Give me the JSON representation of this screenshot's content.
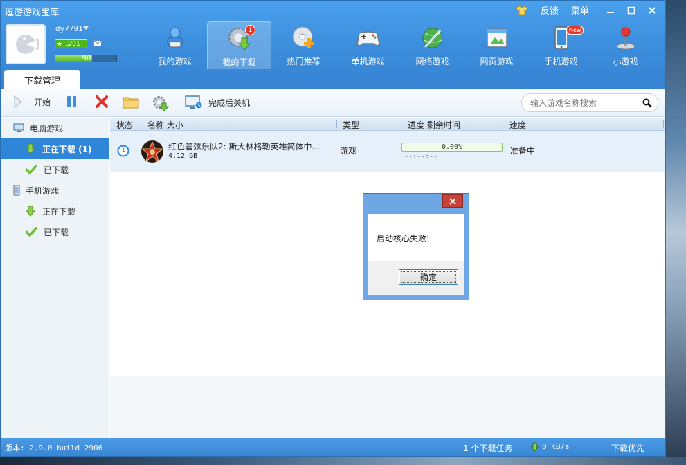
{
  "app": {
    "title": "逗游游戏宝库",
    "feedback": "反馈",
    "menu": "菜单"
  },
  "user": {
    "name": "dy7791",
    "level": "LV01",
    "exp": "90"
  },
  "nav": [
    {
      "label": "我的游戏",
      "icon": "person-gamepad-icon"
    },
    {
      "label": "我的下载",
      "icon": "gear-download-icon",
      "badge": "1"
    },
    {
      "label": "热门推荐",
      "icon": "disc-plus-icon"
    },
    {
      "label": "单机游戏",
      "icon": "gamepad-icon"
    },
    {
      "label": "网络游戏",
      "icon": "globe-sword-icon"
    },
    {
      "label": "网页游戏",
      "icon": "webpage-icon"
    },
    {
      "label": "手机游戏",
      "icon": "phone-icon",
      "badge": "New"
    },
    {
      "label": "小游戏",
      "icon": "joystick-icon"
    }
  ],
  "tab": "下载管理",
  "toolbar": {
    "start": "开始",
    "shutdown": "完成后关机",
    "search_placeholder": "输入游戏名称搜索"
  },
  "sidebar": {
    "pc_games": "电脑游戏",
    "pc_downloading": "正在下载 (1)",
    "pc_downloaded": "已下载",
    "mobile_games": "手机游戏",
    "mobile_downloading": "正在下载",
    "mobile_downloaded": "已下载"
  },
  "columns": {
    "status": "状态",
    "name_size": "名称 大小",
    "type": "类型",
    "progress_time": "进度 剩余时间",
    "speed": "速度"
  },
  "downloads": [
    {
      "name": "红色管弦乐队2: 斯大林格勒英雄简体中...",
      "size": "4.12 GB",
      "type": "游戏",
      "progress": "0.00%",
      "progress_value": 0,
      "remaining": "--:--:--",
      "speed": "准备中"
    }
  ],
  "dialog": {
    "message": "启动核心失败!",
    "ok": "确定"
  },
  "status": {
    "version": "版本: 2.9.0 build 2906",
    "tasks": "1 个下载任务",
    "speed": "0 KB/s",
    "priority": "下载优先"
  },
  "colors": {
    "header_blue": "#3b8ddc",
    "active_blue": "#2f86d8",
    "close_red": "#c8433a"
  }
}
